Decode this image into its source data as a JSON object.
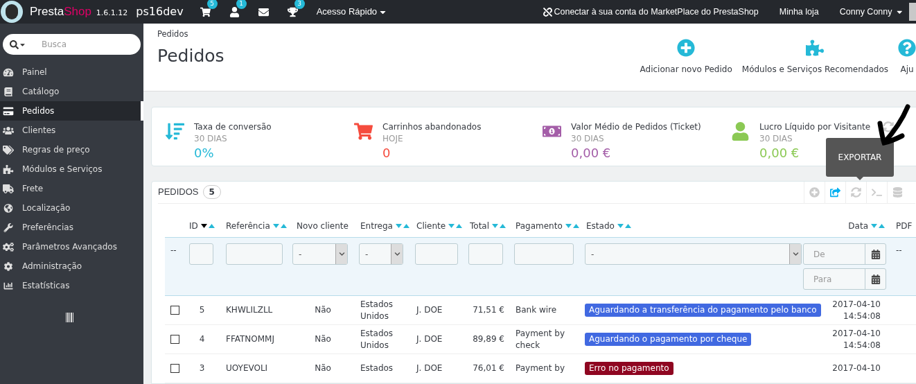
{
  "topbar": {
    "brand_first": "Presta",
    "brand_second": "Shop",
    "version": "1.6.1.12",
    "shop_name": "ps16dev",
    "notifications": [
      {
        "kind": "cart",
        "count": "5"
      },
      {
        "kind": "customer",
        "count": "1"
      },
      {
        "kind": "message"
      },
      {
        "kind": "trophy",
        "count": "3"
      }
    ],
    "quick_access": "Acesso Rápido",
    "marketplace_link": "Conectar à sua conta do MarketPlace do PrestaShop",
    "my_shop": "Minha loja",
    "user": "Conny Conny"
  },
  "sidebar": {
    "search": {
      "placeholder": "Busca"
    },
    "items": [
      {
        "kind": "dashboard",
        "label": "Painel",
        "selected": false
      },
      {
        "kind": "catalog",
        "label": "Catálogo",
        "selected": false
      },
      {
        "kind": "orders",
        "label": "Pedidos",
        "selected": true
      },
      {
        "kind": "customers",
        "label": "Clientes",
        "selected": false
      },
      {
        "kind": "prices",
        "label": "Regras de preço",
        "selected": false
      },
      {
        "kind": "modules",
        "label": "Módulos e Serviços",
        "selected": false
      },
      {
        "kind": "shipping",
        "label": "Frete",
        "selected": false
      },
      {
        "kind": "localization",
        "label": "Localização",
        "selected": false
      },
      {
        "kind": "preferences",
        "label": "Preferências",
        "selected": false
      },
      {
        "kind": "advanced",
        "label": "Parâmetros Avançados",
        "selected": false
      },
      {
        "kind": "admin",
        "label": "Administração",
        "selected": false
      },
      {
        "kind": "stats",
        "label": "Estatísticas",
        "selected": false
      }
    ]
  },
  "header": {
    "breadcrumb": "Pedidos",
    "title": "Pedidos",
    "actions": [
      {
        "kind": "add",
        "label": "Adicionar novo Pedido"
      },
      {
        "kind": "modules",
        "label": "Módulos e Serviços Recomendados"
      },
      {
        "kind": "help",
        "label": "Aju"
      }
    ]
  },
  "kpis": [
    {
      "kind": "conversion",
      "title": "Taxa de conversão",
      "period": "30 DIAS",
      "value": "0%",
      "color": "#25b9d7"
    },
    {
      "kind": "carts",
      "title": "Carrinhos abandonados",
      "period": "HOJE",
      "value": "0",
      "color": "#f54c3e"
    },
    {
      "kind": "average",
      "title": "Valor Médio de Pedidos (Ticket)",
      "period": "30 DIAS",
      "value": "0,00 €",
      "color": "#a45ea8"
    },
    {
      "kind": "profit",
      "title": "Lucro Líquido por Visitante",
      "period": "30 DIAS",
      "value": "0,00 €",
      "color": "#8bc954"
    }
  ],
  "orders": {
    "title": "PEDIDOS",
    "count": "5",
    "tooltip": "EXPORTAR",
    "tools": [
      {
        "kind": "add",
        "selected": false
      },
      {
        "kind": "export",
        "selected": true
      },
      {
        "kind": "refresh",
        "selected": false
      },
      {
        "kind": "sql",
        "selected": false
      },
      {
        "kind": "database",
        "selected": false
      }
    ],
    "columns": [
      {
        "label": "ID",
        "sortable": true,
        "sort_active": true
      },
      {
        "label": "Referência",
        "sortable": true,
        "sort_active": false
      },
      {
        "label": "Novo cliente",
        "sortable": false
      },
      {
        "label": "Entrega",
        "sortable": true,
        "sort_active": false
      },
      {
        "label": "Cliente",
        "sortable": true,
        "sort_active": false
      },
      {
        "label": "Total",
        "sortable": true,
        "sort_active": false
      },
      {
        "label": "Pagamento",
        "sortable": true,
        "sort_active": false
      },
      {
        "label": "Estado",
        "sortable": true,
        "sort_active": false
      },
      {
        "label": "Data",
        "sortable": true,
        "sort_active": false
      },
      {
        "label": "PDF",
        "sortable": false
      }
    ],
    "filters": {
      "check_column": "--",
      "new_customer": "-",
      "delivery": "-",
      "status": "-",
      "date_from": {
        "placeholder": "De"
      },
      "date_to": {
        "placeholder": "Para"
      },
      "pdf_column": "--"
    },
    "rows": [
      {
        "checked": false,
        "id": "5",
        "reference": "KHWLILZLL",
        "new_customer": "Não",
        "delivery": "Estados Unidos",
        "customer": "J. DOE",
        "total": "71,51 €",
        "payment": "Bank wire",
        "status": {
          "label": "Aguardando a transferência do pagamento pelo banco",
          "color": "#4169e1"
        },
        "date": "2017-04-10",
        "time": "14:54:08"
      },
      {
        "checked": false,
        "id": "4",
        "reference": "FFATNOMMJ",
        "new_customer": "Não",
        "delivery": "Estados Unidos",
        "customer": "J. DOE",
        "total": "89,89 €",
        "payment": "Payment by check",
        "status": {
          "label": "Aguardando o pagamento por cheque",
          "color": "#4169e1"
        },
        "date": "2017-04-10",
        "time": "14:54:08"
      },
      {
        "checked": false,
        "id": "3",
        "reference": "UOYEVOLI",
        "new_customer": "Não",
        "delivery": "Estados",
        "customer": "J. DOE",
        "total": "76,01 €",
        "payment": "Payment by",
        "status": {
          "label": "Erro no pagamento",
          "color": "#8f0621"
        },
        "date": "2017-04-10"
      }
    ]
  }
}
